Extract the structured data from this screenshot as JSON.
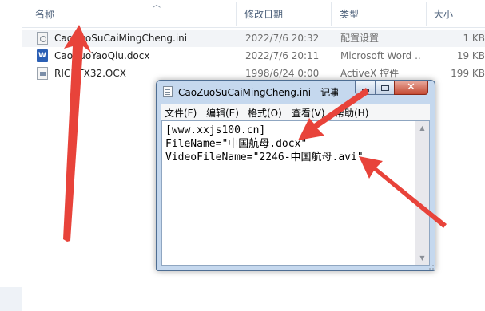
{
  "explorer": {
    "columns": [
      {
        "label": "名称"
      },
      {
        "label": "修改日期"
      },
      {
        "label": "类型"
      },
      {
        "label": "大小"
      }
    ],
    "files": [
      {
        "name": "CaoZuoSuCaiMingCheng.ini",
        "date": "2022/7/6 20:32",
        "type": "配置设置",
        "size": "1 KB",
        "icon": "ini-file-icon",
        "selected": true
      },
      {
        "name": "CaoZuoYaoQiu.docx",
        "date": "2022/7/6 20:11",
        "type": "Microsoft Word ...",
        "size": "19 KB",
        "icon": "word-document-icon",
        "selected": false
      },
      {
        "name": "RICHTX32.OCX",
        "date": "1998/6/24 0:00",
        "type": "ActiveX 控件",
        "size": "199 KB",
        "icon": "activex-control-icon",
        "selected": false
      }
    ]
  },
  "notepad": {
    "title": "CaoZuoSuCaiMingCheng.ini - 记事本",
    "menu": [
      "文件(F)",
      "编辑(E)",
      "格式(O)",
      "查看(V)",
      "帮助(H)"
    ],
    "content": "[www.xxjs100.cn]\nFileName=\"中国航母.docx\"\nVideoFileName=\"2246-中国航母.avi\"",
    "close_glyph": "✕"
  },
  "annotation": {
    "arrow_color": "#e8433a"
  }
}
